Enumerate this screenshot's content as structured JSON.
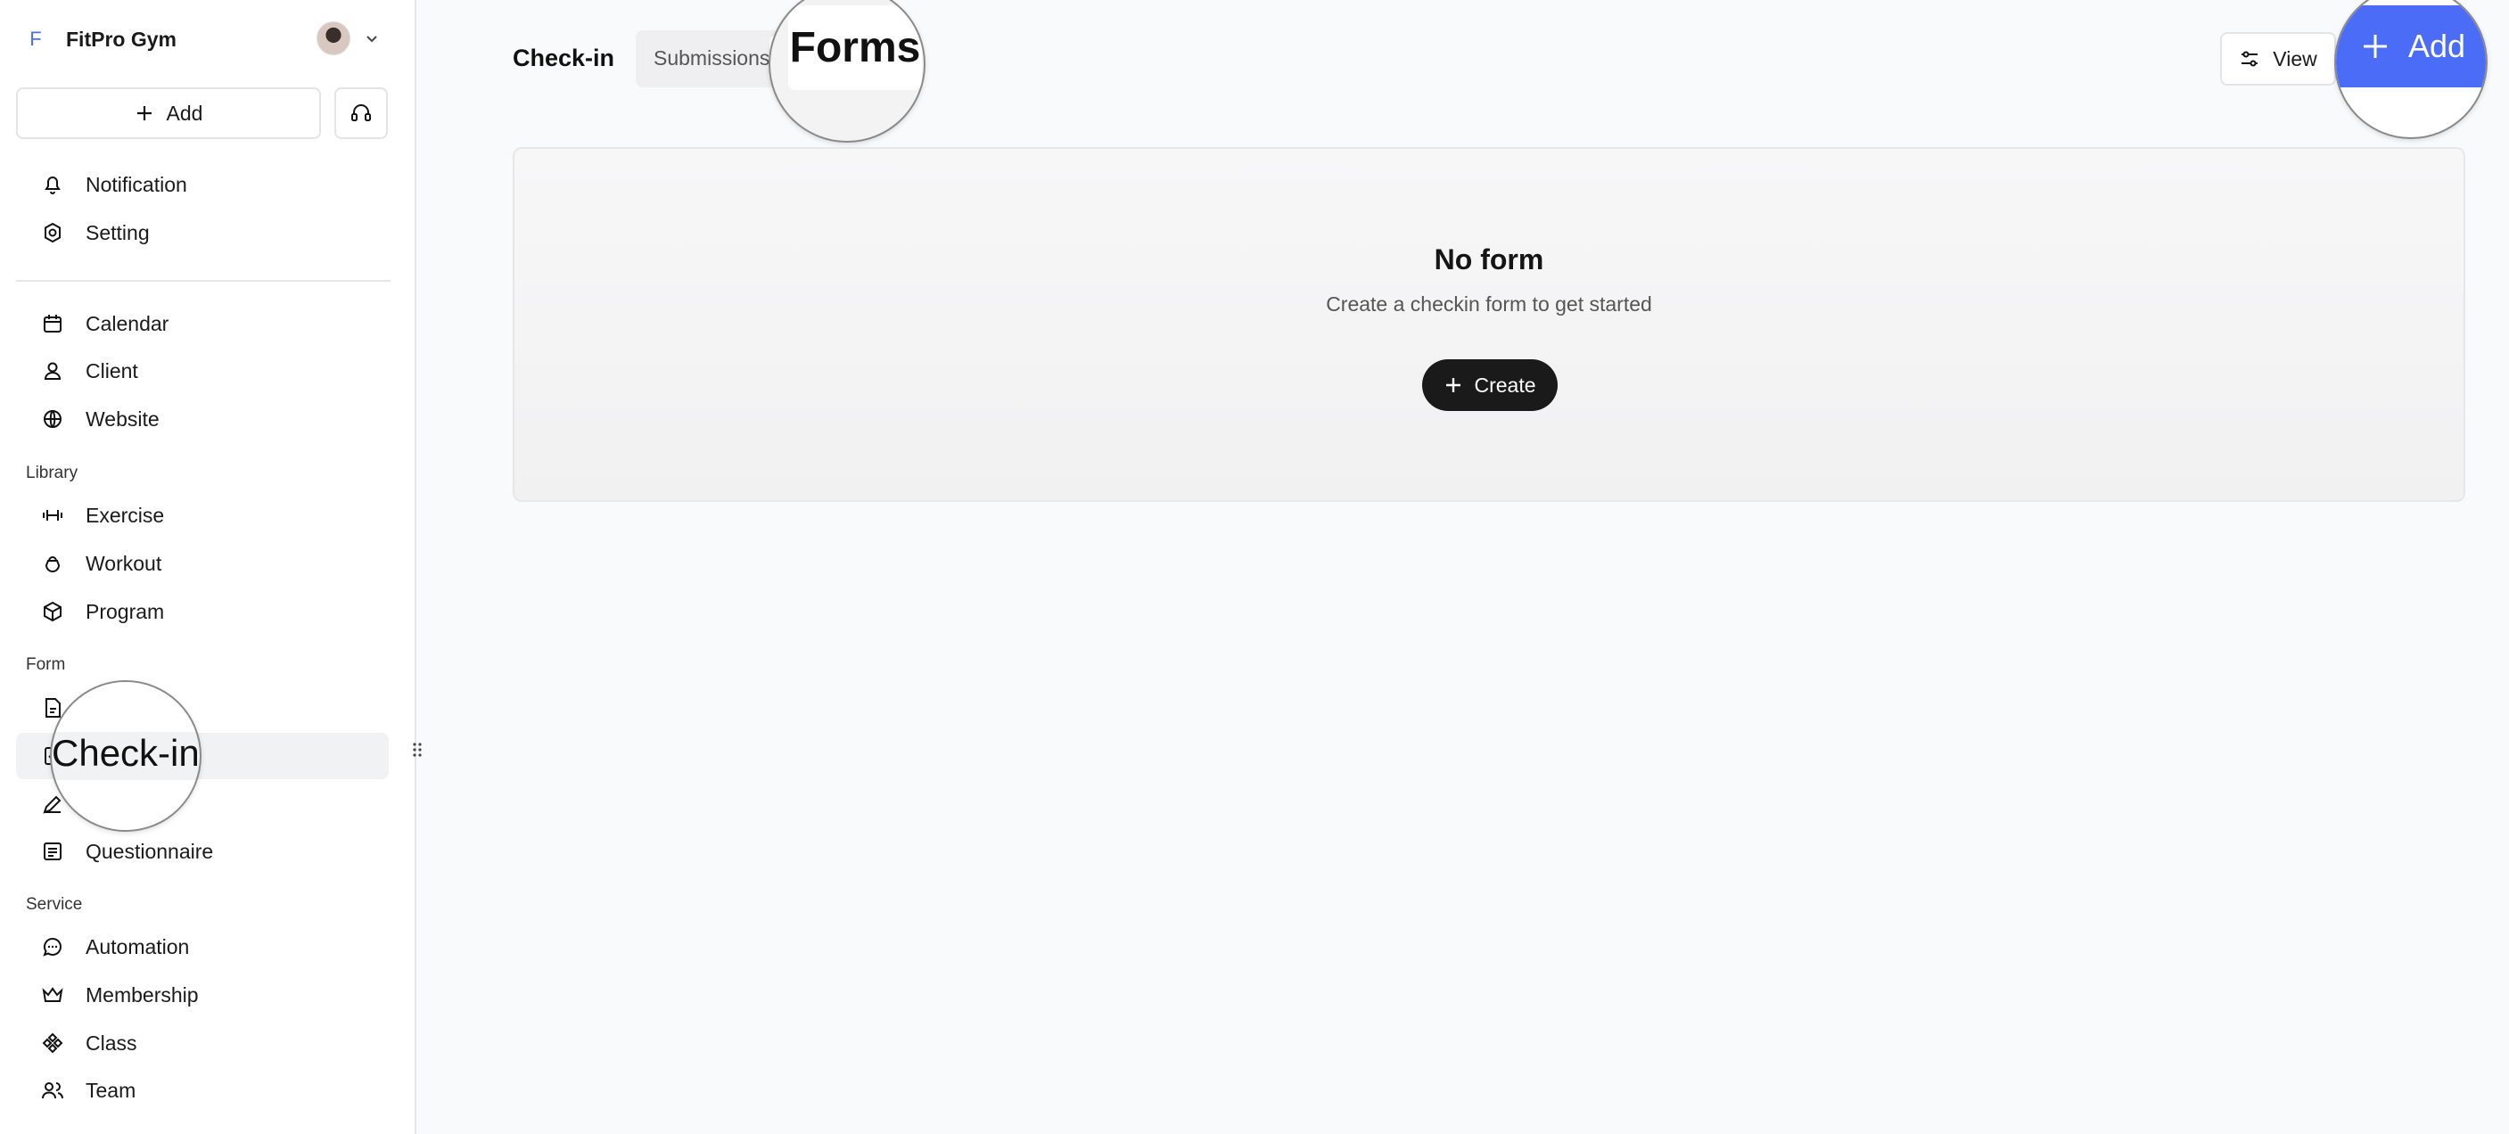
{
  "sidebar": {
    "brand": {
      "initial": "F",
      "name": "FitPro Gym"
    },
    "add_label": "Add",
    "top_items": [
      {
        "label": "Notification",
        "icon": "bell-icon"
      },
      {
        "label": "Setting",
        "icon": "gear-icon"
      }
    ],
    "main_items": [
      {
        "label": "Calendar",
        "icon": "calendar-icon"
      },
      {
        "label": "Client",
        "icon": "user-icon"
      },
      {
        "label": "Website",
        "icon": "globe-icon"
      }
    ],
    "library": {
      "label": "Library",
      "items": [
        {
          "label": "Exercise",
          "icon": "dumbbell-icon"
        },
        {
          "label": "Workout",
          "icon": "kettlebell-icon"
        },
        {
          "label": "Program",
          "icon": "box-icon"
        }
      ]
    },
    "form": {
      "label": "Form",
      "items": [
        {
          "label": "",
          "icon": "document-icon"
        },
        {
          "label": "Check-in",
          "icon": "checkin-icon",
          "active": true
        },
        {
          "label": "",
          "icon": "pen-icon"
        },
        {
          "label": "Questionnaire",
          "icon": "list-icon"
        }
      ]
    },
    "service": {
      "label": "Service",
      "items": [
        {
          "label": "Automation",
          "icon": "chat-icon"
        },
        {
          "label": "Membership",
          "icon": "crown-icon"
        },
        {
          "label": "Class",
          "icon": "class-icon"
        },
        {
          "label": "Team",
          "icon": "team-icon"
        }
      ]
    }
  },
  "header": {
    "title": "Check-in",
    "tabs": [
      {
        "label": "Submissions"
      },
      {
        "label": "Forms",
        "active": true
      }
    ],
    "view_label": "View",
    "add_label": "Add"
  },
  "empty_state": {
    "title": "No form",
    "subtitle": "Create a checkin form to get started",
    "create_label": "Create"
  },
  "colors": {
    "accent": "#4a6cf7",
    "dark_button": "#1a1a1a"
  }
}
